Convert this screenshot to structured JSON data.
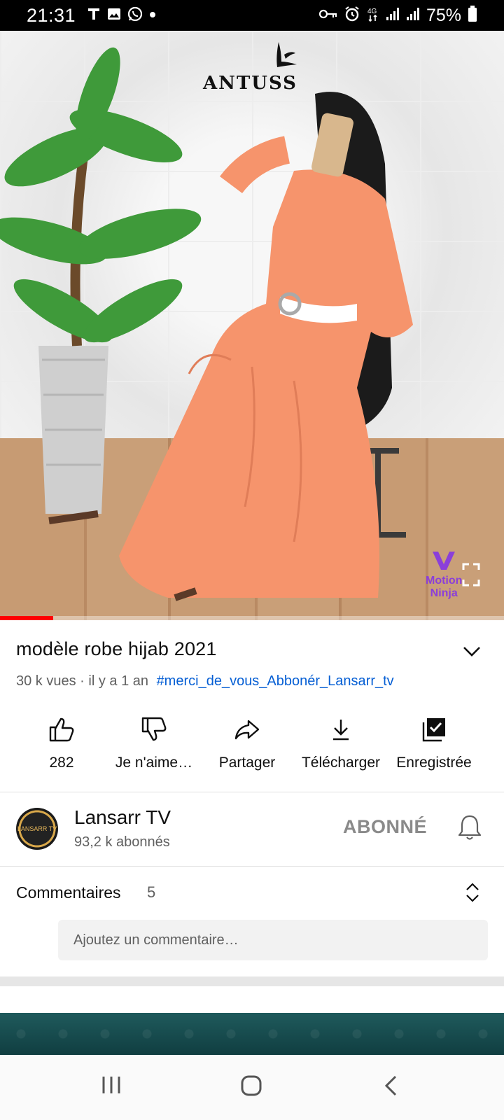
{
  "status_bar": {
    "time": "21:31",
    "battery": "75%",
    "left_icons": [
      "t-app-icon",
      "gallery-icon",
      "whatsapp-icon",
      "dot-icon"
    ],
    "right_icons": [
      "vpn-key-icon",
      "alarm-icon",
      "4g-icon",
      "signal-icon",
      "signal-icon",
      "battery-icon"
    ]
  },
  "video": {
    "brand": "ANTUSS",
    "watermark_line1": "Motion",
    "watermark_line2": "Ninja",
    "progress_fraction": 0.105
  },
  "info": {
    "title": "modèle robe hijab 2021",
    "views": "30 k vues",
    "age": "il y a 1 an",
    "separator": " · ",
    "hashtag": "#merci_de_vous_Abbonér_Lansarr_tv"
  },
  "actions": {
    "like": "282",
    "dislike": "Je n'aime…",
    "share": "Partager",
    "download": "Télécharger",
    "save": "Enregistrée"
  },
  "channel": {
    "name": "Lansarr TV",
    "subscribers": "93,2 k abonnés",
    "subscribe_state": "ABONNÉ",
    "avatar_text": "LANSARR TV"
  },
  "comments": {
    "title": "Commentaires",
    "count": "5",
    "placeholder": "Ajoutez un commentaire…"
  },
  "colors": {
    "accent_link": "#065fd4",
    "progress": "#ff0000",
    "watermark": "#8b3fd9"
  }
}
